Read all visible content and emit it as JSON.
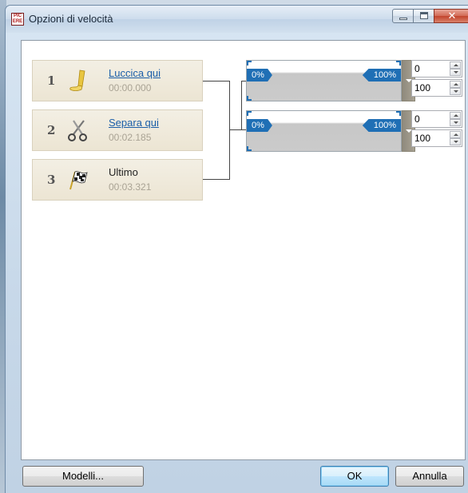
{
  "window": {
    "title": "Opzioni di velocità",
    "icon_text": [
      "PIC",
      "ERE"
    ]
  },
  "items": [
    {
      "number": "1",
      "title": "Luccica qui",
      "time": "00:00.000",
      "icon": "glitter-tube-icon",
      "link": true
    },
    {
      "number": "2",
      "title": "Separa qui",
      "time": "00:02.185",
      "icon": "scissors-icon",
      "link": true
    },
    {
      "number": "3",
      "title": "Ultimo",
      "time": "00:03.321",
      "icon": "checkered-flag-icon",
      "link": false
    }
  ],
  "segments": [
    {
      "start_label": "0%",
      "end_label": "100%",
      "start_value": "0",
      "end_value": "100"
    },
    {
      "start_label": "0%",
      "end_label": "100%",
      "start_value": "0",
      "end_value": "100"
    }
  ],
  "buttons": {
    "models": "Modelli...",
    "ok": "OK",
    "cancel": "Annulla"
  },
  "colors": {
    "accent": "#1f6fb5",
    "link": "#1b5ea8",
    "item_bg": "#ece5d3"
  }
}
